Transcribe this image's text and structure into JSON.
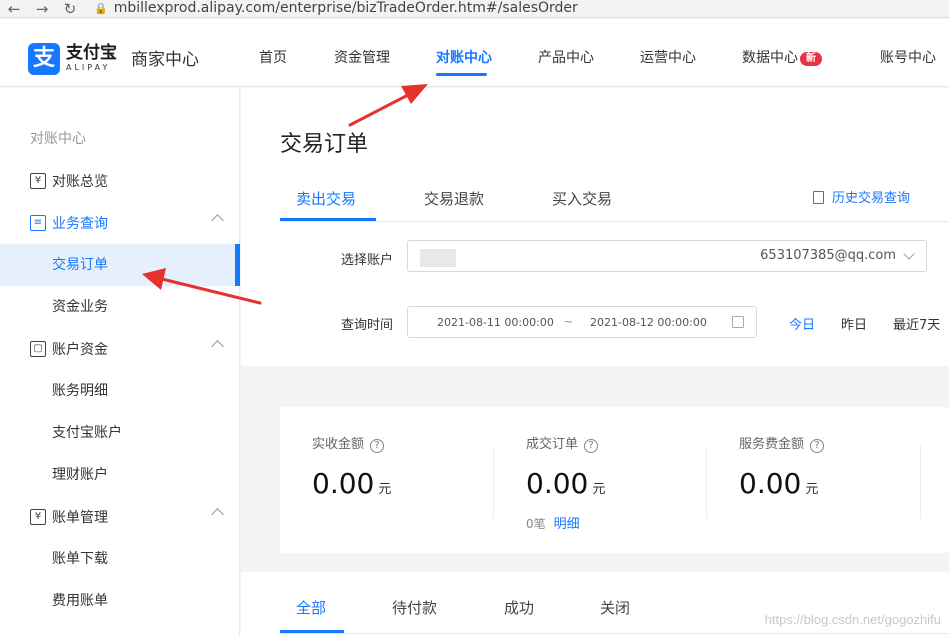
{
  "browser": {
    "back": "←",
    "forward": "→",
    "reload": "↻",
    "lock": "🔒",
    "url": "mbillexprod.alipay.com/enterprise/bizTradeOrder.htm#/salesOrder"
  },
  "header": {
    "logo_glyph": "支",
    "brand_name": "支付宝",
    "brand_sub": "ALIPAY",
    "merchant_center": "商家中心",
    "nav": [
      {
        "label": "首页"
      },
      {
        "label": "资金管理"
      },
      {
        "label": "对账中心"
      },
      {
        "label": "产品中心"
      },
      {
        "label": "运营中心"
      },
      {
        "label": "数据中心"
      },
      {
        "label": "账号中心"
      }
    ],
    "new_badge": "新",
    "active_nav": "对账中心"
  },
  "sidebar": {
    "heading": "对账中心",
    "items": [
      {
        "label": "对账总览",
        "icon": "yen-doc-icon"
      },
      {
        "label": "业务查询",
        "icon": "search-doc-icon"
      },
      {
        "label": "交易订单"
      },
      {
        "label": "资金业务"
      },
      {
        "label": "账户资金",
        "icon": "wallet-icon"
      },
      {
        "label": "账务明细"
      },
      {
        "label": "支付宝账户"
      },
      {
        "label": "理财账户"
      },
      {
        "label": "账单管理",
        "icon": "yen-doc-icon"
      },
      {
        "label": "账单下载"
      },
      {
        "label": "费用账单"
      }
    ],
    "icon_glyphs": {
      "yen": "¥",
      "search": "≡",
      "wallet": "▢"
    }
  },
  "main": {
    "title": "交易订单",
    "tabs": [
      {
        "label": "卖出交易"
      },
      {
        "label": "交易退款"
      },
      {
        "label": "买入交易"
      }
    ],
    "history_link": "历史交易查询",
    "account_label": "选择账户",
    "account_email": "653107385@qq.com",
    "time_label": "查询时间",
    "date_start": "2021-08-11 00:00:00",
    "date_sep": "~",
    "date_end": "2021-08-12 00:00:00",
    "quick_dates": [
      "今日",
      "昨日",
      "最近7天"
    ]
  },
  "stats": [
    {
      "label": "实收金额",
      "value": "0.00",
      "unit": "元"
    },
    {
      "label": "成交订单",
      "value": "0.00",
      "unit": "元"
    },
    {
      "label": "服务费金额",
      "value": "0.00",
      "unit": "元"
    }
  ],
  "stats_help": "?",
  "orders_sub": {
    "count": "0笔",
    "link": "明细"
  },
  "order_tabs": [
    {
      "label": "全部"
    },
    {
      "label": "待付款"
    },
    {
      "label": "成功"
    },
    {
      "label": "关闭"
    }
  ],
  "watermark": "https://blog.csdn.net/gogozhifu",
  "colors": {
    "accent": "#1677ff",
    "annotation": "#e5322d",
    "badge": "#e8333e"
  }
}
